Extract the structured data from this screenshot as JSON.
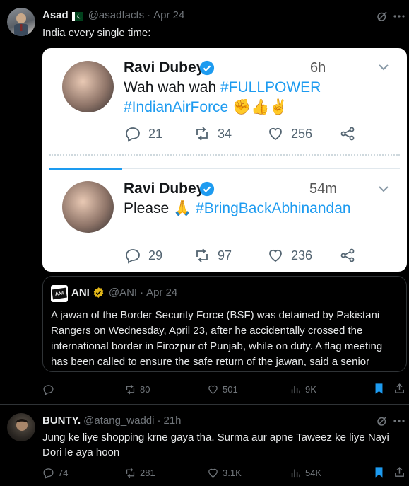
{
  "tweet1": {
    "display_name": "Asad",
    "flag": "🇵🇰",
    "handle": "@asadfacts",
    "separator": "·",
    "date": "Apr 24",
    "text": "India every single time:",
    "embed": {
      "tweet_a": {
        "name": "Ravi Dubey",
        "time": "6h",
        "text_plain": "Wah wah wah",
        "hashtag1": "#FULLPOWER",
        "hashtag2": "#IndianAirForce",
        "emojis": "✊👍✌",
        "replies": "21",
        "retweets": "34",
        "likes": "256"
      },
      "tweet_b": {
        "name": "Ravi Dubey",
        "time": "54m",
        "text_plain": "Please",
        "emoji": "🙏",
        "hashtag": "#BringBackAbhinandan",
        "replies": "29",
        "retweets": "97",
        "likes": "236"
      }
    },
    "quote": {
      "display_name": "ANI",
      "handle": "@ANI",
      "separator": "·",
      "date": "Apr 24",
      "logo_text": "ANI",
      "text": "A jawan of the Border Security Force (BSF) was detained by Pakistani Rangers on Wednesday, April 23, after he accidentally crossed the international border in Firozpur of Punjab, while on duty. A flag meeting has been called to ensure the safe return of the jawan, said a senior"
    },
    "stats": {
      "replies": "",
      "retweets": "80",
      "likes": "501",
      "views": "9K"
    }
  },
  "tweet2": {
    "display_name": "BUNTY.",
    "handle": "@atang_waddi",
    "separator": "·",
    "date": "21h",
    "text": "Jung ke liye shopping krne gaya tha. Surma aur apne Taweez ke liye Nayi Dori le aya hoon",
    "stats": {
      "replies": "74",
      "retweets": "281",
      "likes": "3.1K",
      "views": "54K"
    }
  },
  "colors": {
    "accent": "#1d9bf0",
    "background": "#000000",
    "muted": "#71767b",
    "gold_badge": "#e2b719"
  }
}
